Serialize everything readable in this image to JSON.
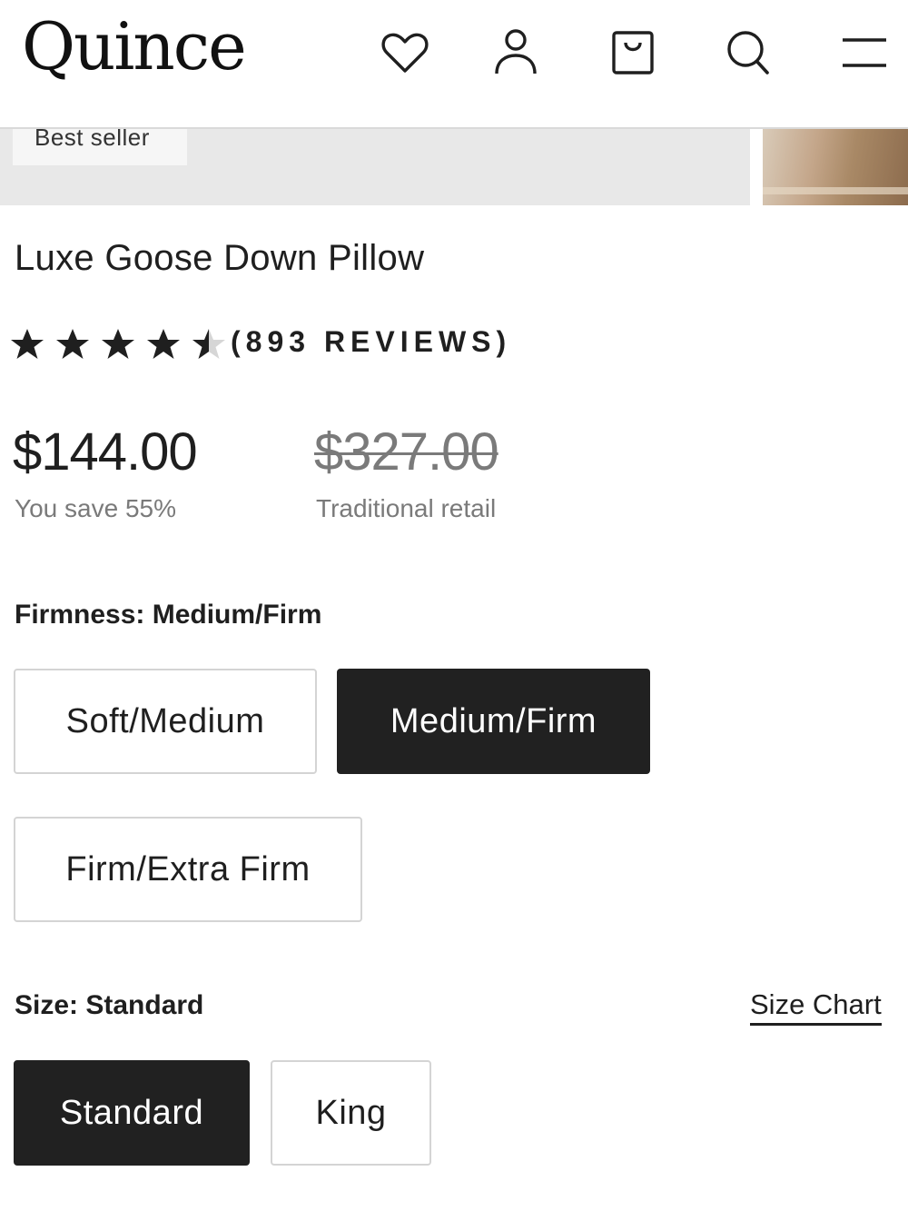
{
  "header": {
    "logo": "Quince",
    "icons": [
      "heart-icon",
      "user-icon",
      "shopping-bag-icon",
      "search-icon",
      "menu-icon"
    ]
  },
  "gallery": {
    "badge": "Best seller"
  },
  "product": {
    "title": "Luxe Goose Down Pillow",
    "rating": 4.5,
    "rating_max": 5,
    "reviews_label": "(893 REVIEWS)",
    "price": "$144.00",
    "savings": "You save 55%",
    "original_price": "$327.00",
    "original_price_label": "Traditional retail"
  },
  "firmness": {
    "label": "Firmness: Medium/Firm",
    "options": [
      "Soft/Medium",
      "Medium/Firm",
      "Firm/Extra Firm"
    ],
    "selected": "Medium/Firm"
  },
  "size": {
    "label": "Size: Standard",
    "chart_link": "Size Chart",
    "options": [
      "Standard",
      "King"
    ],
    "selected": "Standard"
  },
  "colors": {
    "text": "#1f1f1f",
    "muted": "#7a7a7a",
    "selected_bg": "#212121",
    "border": "#d4d4d4"
  }
}
